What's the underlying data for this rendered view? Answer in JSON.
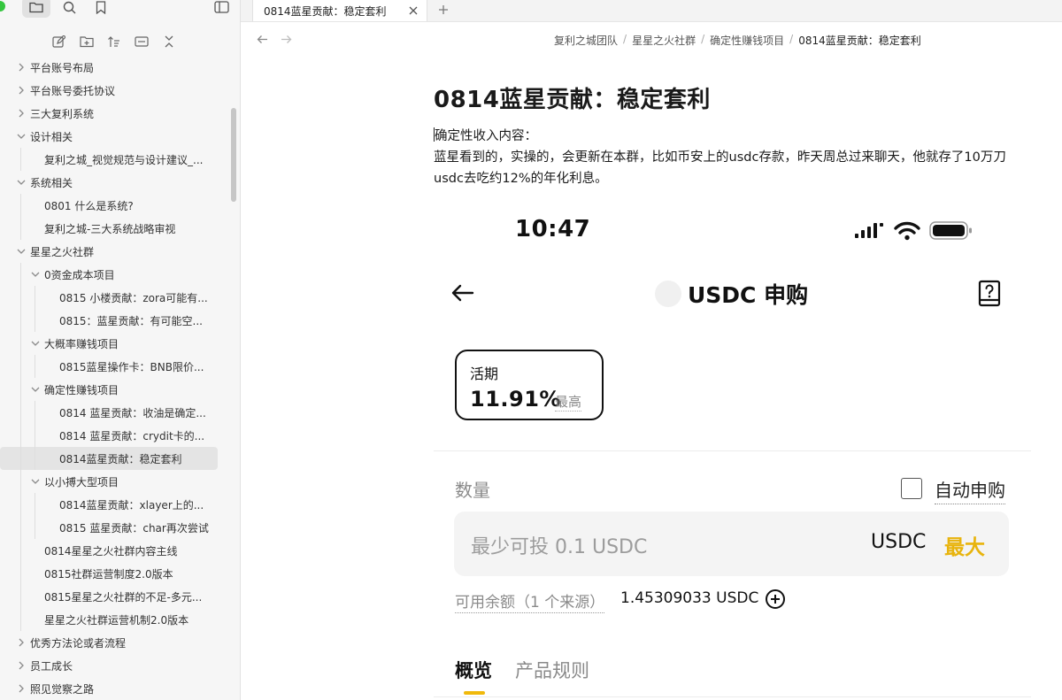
{
  "sidebar": {
    "tree": [
      {
        "label": "平台账号布局",
        "depth": 0,
        "collapsed": true
      },
      {
        "label": "平台账号委托协议",
        "depth": 0,
        "collapsed": true
      },
      {
        "label": "三大复利系统",
        "depth": 0,
        "collapsed": true
      },
      {
        "label": "设计相关",
        "depth": 0,
        "collapsed": false
      },
      {
        "label": "复利之城_视觉规范与设计建议_...",
        "depth": 1,
        "file": true
      },
      {
        "label": "系统相关",
        "depth": 0,
        "collapsed": false
      },
      {
        "label": "0801 什么是系统?",
        "depth": 1,
        "file": true
      },
      {
        "label": "复利之城-三大系统战略审视",
        "depth": 1,
        "file": true
      },
      {
        "label": "星星之火社群",
        "depth": 0,
        "collapsed": false
      },
      {
        "label": "0资金成本项目",
        "depth": 1,
        "collapsed": false
      },
      {
        "label": "0815 小楼贡献：zora可能有...",
        "depth": 2,
        "file": true
      },
      {
        "label": "0815：蓝星贡献：有可能空...",
        "depth": 2,
        "file": true
      },
      {
        "label": "大概率赚钱项目",
        "depth": 1,
        "collapsed": false
      },
      {
        "label": "0815蓝星操作卡：BNB限价...",
        "depth": 2,
        "file": true
      },
      {
        "label": "确定性赚钱项目",
        "depth": 1,
        "collapsed": false
      },
      {
        "label": "0814 蓝星贡献：收油是确定...",
        "depth": 2,
        "file": true
      },
      {
        "label": "0814 蓝星贡献：crydit卡的...",
        "depth": 2,
        "file": true
      },
      {
        "label": "0814蓝星贡献：稳定套利",
        "depth": 2,
        "file": true,
        "active": true
      },
      {
        "label": "以小搏大型项目",
        "depth": 1,
        "collapsed": false
      },
      {
        "label": "0814蓝星贡献：xlayer上的...",
        "depth": 2,
        "file": true
      },
      {
        "label": "0815 蓝星贡献：char再次尝试",
        "depth": 2,
        "file": true
      },
      {
        "label": "0814星星之火社群内容主线",
        "depth": 1,
        "file": true
      },
      {
        "label": "0815社群运营制度2.0版本",
        "depth": 1,
        "file": true
      },
      {
        "label": "0815星星之火社群的不足-多元...",
        "depth": 1,
        "file": true
      },
      {
        "label": "星星之火社群运营机制2.0版本",
        "depth": 1,
        "file": true
      },
      {
        "label": "优秀方法论或者流程",
        "depth": 0,
        "collapsed": true
      },
      {
        "label": "员工成长",
        "depth": 0,
        "collapsed": true
      },
      {
        "label": "照见觉察之路",
        "depth": 0,
        "collapsed": true
      }
    ]
  },
  "tab": {
    "label": "0814蓝星贡献：稳定套利"
  },
  "breadcrumb": [
    "复利之城团队",
    "星星之火社群",
    "确定性赚钱项目",
    "0814蓝星贡献：稳定套利"
  ],
  "note": {
    "title": "0814蓝星贡献：稳定套利",
    "line1": "确定性收入内容：",
    "line2": "蓝星看到的，实操的，会更新在本群，比如币安上的usdc存款，昨天周总过来聊天，他就存了10万刀usdc去吃约12%的年化利息。"
  },
  "phone": {
    "time": "10:47",
    "title": "USDC 申购",
    "card": {
      "label": "活期",
      "rate": "11.91%",
      "tag": "最高"
    },
    "qty_label": "数量",
    "auto_label": "自动申购",
    "input": {
      "placeholder": "最少可投 0.1 USDC",
      "unit": "USDC",
      "max": "最大"
    },
    "available": {
      "label": "可用余额（1 个来源）",
      "value": "1.45309033 USDC"
    },
    "tabs": {
      "overview": "概览",
      "rules": "产品规则"
    },
    "accent": "#F0B90B"
  }
}
